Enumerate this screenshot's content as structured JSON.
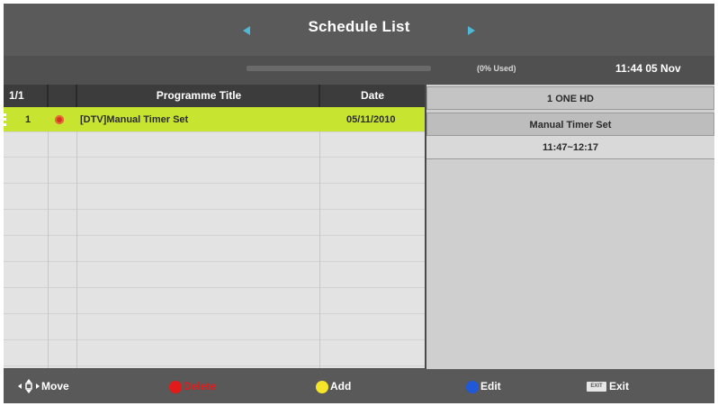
{
  "header": {
    "title": "Schedule List",
    "usage": "(0% Used)",
    "clock": "11:44 05 Nov"
  },
  "list": {
    "columns": {
      "page": "1/1",
      "title": "Programme Title",
      "date": "Date"
    },
    "rows": [
      {
        "index": "1",
        "title": "[DTV]Manual Timer Set",
        "date": "05/11/2010",
        "icon": "record-icon"
      }
    ]
  },
  "detail": {
    "channel": "1 ONE HD",
    "event": "Manual Timer Set",
    "time": "11:47~12:17"
  },
  "footer": {
    "move": "Move",
    "delete": "Delete",
    "add": "Add",
    "edit": "Edit",
    "exit": "Exit",
    "exit_key": "EXIT"
  },
  "colors": {
    "selected_row": "#c7e430",
    "red_key": "#e21a1a",
    "yellow_key": "#f4e52a",
    "blue_key": "#1f59d8"
  }
}
